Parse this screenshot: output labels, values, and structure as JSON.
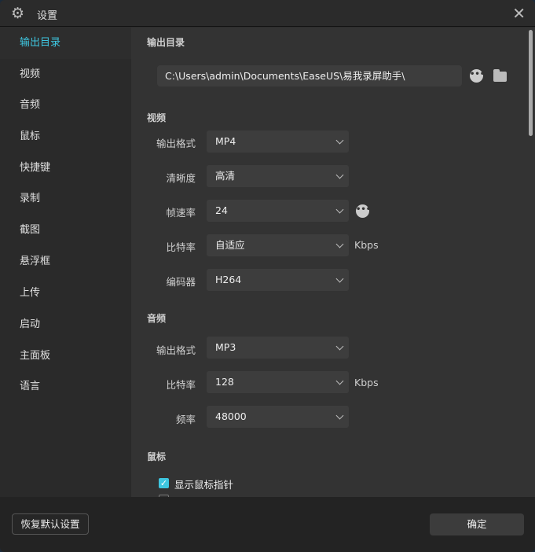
{
  "window": {
    "title": "设置"
  },
  "sidebar": {
    "items": [
      {
        "label": "输出目录"
      },
      {
        "label": "视频"
      },
      {
        "label": "音频"
      },
      {
        "label": "鼠标"
      },
      {
        "label": "快捷键"
      },
      {
        "label": "录制"
      },
      {
        "label": "截图"
      },
      {
        "label": "悬浮框"
      },
      {
        "label": "上传"
      },
      {
        "label": "启动"
      },
      {
        "label": "主面板"
      },
      {
        "label": "语言"
      }
    ]
  },
  "output": {
    "title": "输出目录",
    "path": "C:\\Users\\admin\\Documents\\EaseUS\\易我录屏助手\\"
  },
  "video": {
    "title": "视频",
    "format_label": "输出格式",
    "format": "MP4",
    "quality_label": "清晰度",
    "quality": "高清",
    "fps_label": "帧速率",
    "fps": "24",
    "bitrate_label": "比特率",
    "bitrate": "自适应",
    "bitrate_unit": "Kbps",
    "encoder_label": "编码器",
    "encoder": "H264"
  },
  "audio": {
    "title": "音频",
    "format_label": "输出格式",
    "format": "MP3",
    "bitrate_label": "比特率",
    "bitrate": "128",
    "bitrate_unit": "Kbps",
    "freq_label": "频率",
    "freq": "48000"
  },
  "mouse": {
    "title": "鼠标",
    "show_pointer_label": "显示鼠标指针",
    "show_pointer": true
  },
  "footer": {
    "reset_label": "恢复默认设置",
    "ok_label": "确定"
  },
  "colors": {
    "accent": "#3ec6e0"
  }
}
